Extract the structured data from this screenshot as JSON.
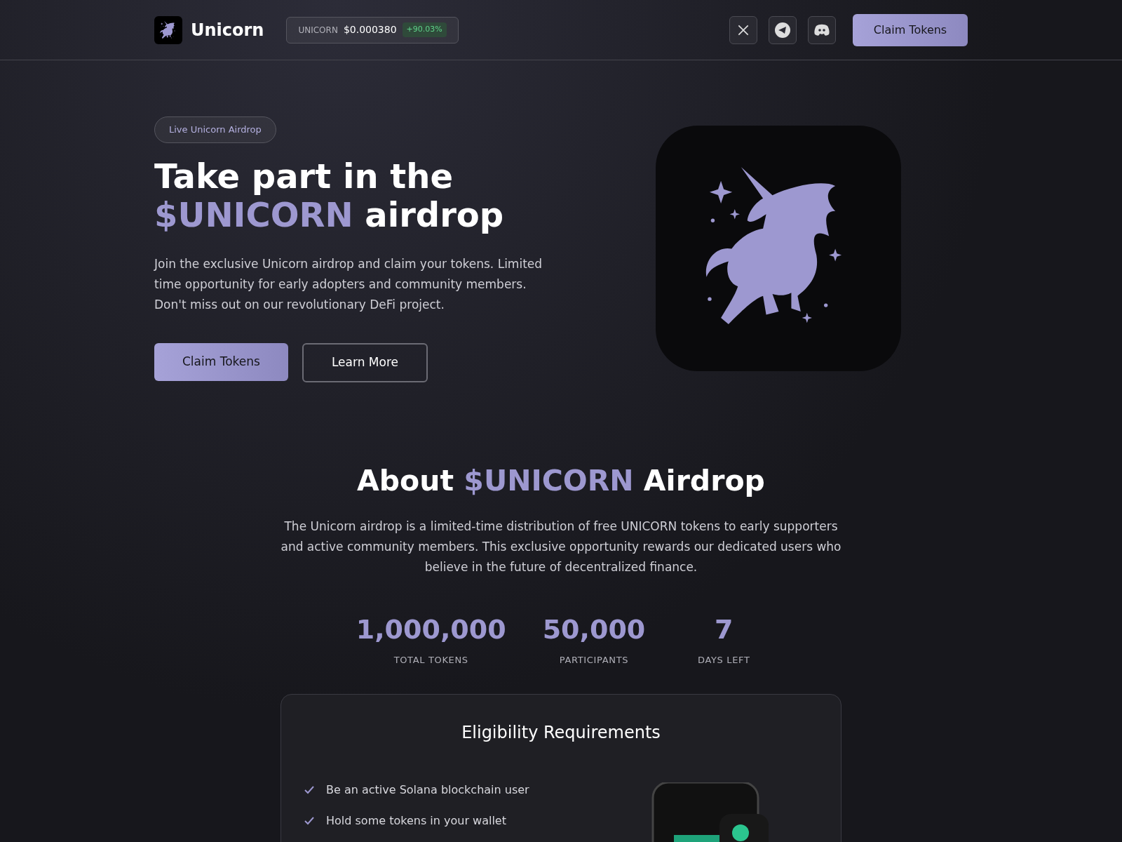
{
  "header": {
    "brand": "Unicorn",
    "ticker": {
      "symbol": "UNICORN",
      "price": "$0.000380",
      "change": "+90.03%"
    },
    "cta": "Claim Tokens"
  },
  "hero": {
    "badge": "Live Unicorn Airdrop",
    "title_line1": "Take part in the",
    "title_highlight": "$UNICORN",
    "title_rest": "airdrop",
    "description": "Join the exclusive Unicorn airdrop and claim your tokens. Limited time opportunity for early adopters and community members. Don't miss out on our revolutionary DeFi project.",
    "buttons": [
      {
        "label": "Claim Tokens",
        "kind": "primary"
      },
      {
        "label": "Learn More",
        "kind": "outline"
      }
    ]
  },
  "about": {
    "heading_start": "About",
    "heading_highlight": "$UNICORN",
    "heading_end": "Airdrop",
    "description": "The Unicorn airdrop is a limited-time distribution of free UNICORN tokens to early supporters and active community members. This exclusive opportunity rewards our dedicated users who believe in the future of decentralized finance.",
    "stats": [
      {
        "value": "1,000,000",
        "label": "TOTAL TOKENS"
      },
      {
        "value": "50,000",
        "label": "PARTICIPANTS"
      },
      {
        "value": "7",
        "label": "DAYS LEFT"
      }
    ]
  },
  "eligibility": {
    "title": "Eligibility Requirements",
    "items": [
      "Be an active Solana blockchain user",
      "Hold some tokens in your wallet"
    ]
  }
}
